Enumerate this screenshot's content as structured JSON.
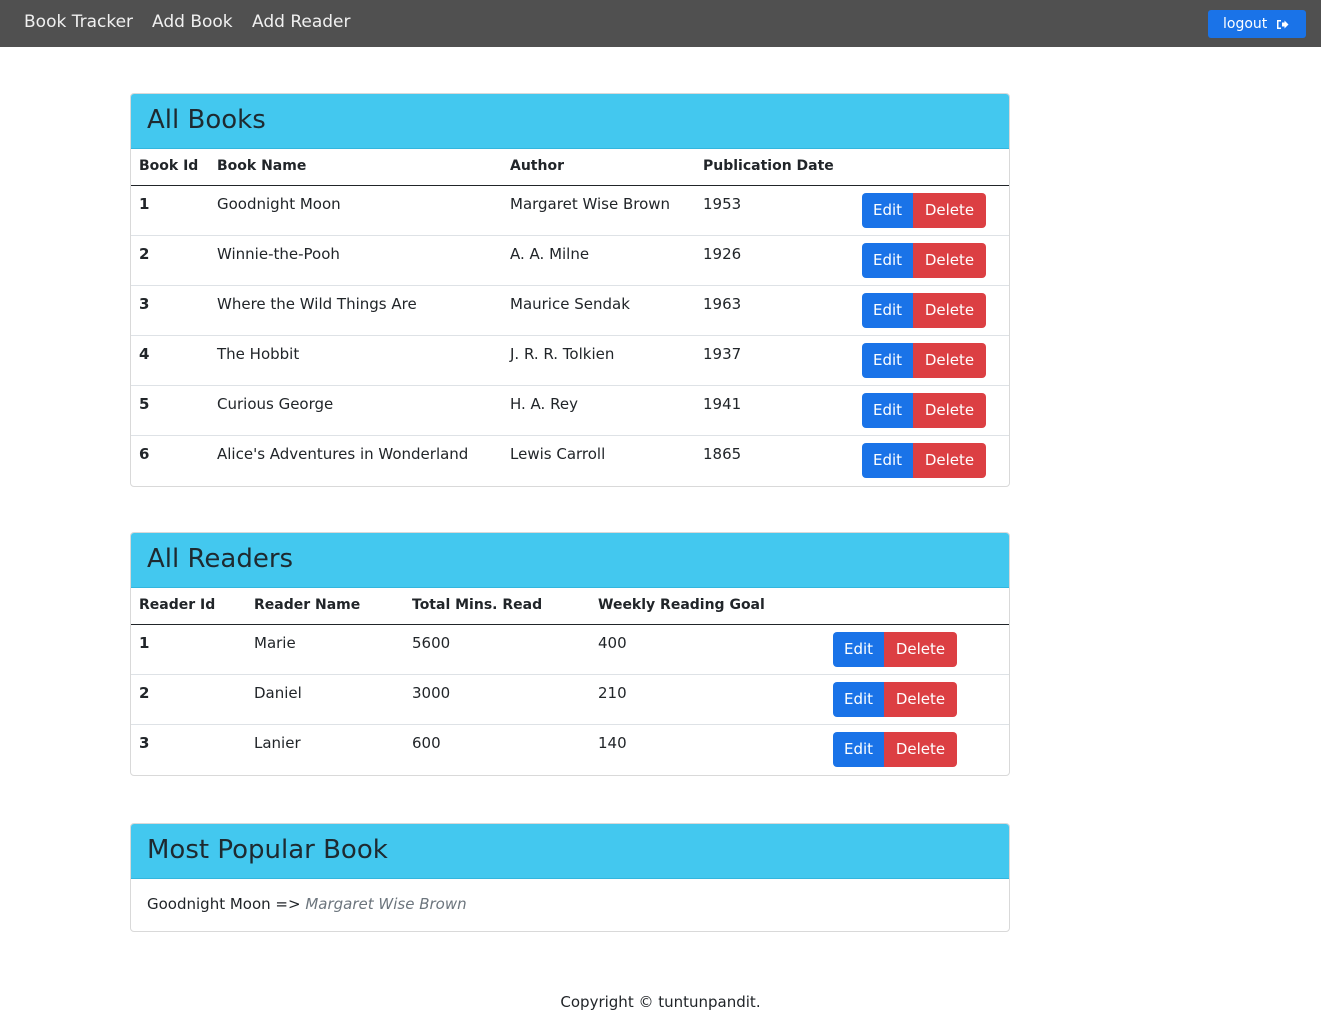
{
  "nav": {
    "brand": "Book Tracker",
    "add_book": "Add Book",
    "add_reader": "Add Reader",
    "logout": "logout",
    "logout_icon": "sign-out-icon"
  },
  "books": {
    "title": "All Books",
    "columns": [
      "Book Id",
      "Book Name",
      "Author",
      "Publication Date"
    ],
    "rows": [
      {
        "id": "1",
        "name": "Goodnight Moon",
        "author": "Margaret Wise Brown",
        "date": "1953"
      },
      {
        "id": "2",
        "name": "Winnie-the-Pooh",
        "author": "A. A. Milne",
        "date": "1926"
      },
      {
        "id": "3",
        "name": "Where the Wild Things Are",
        "author": "Maurice Sendak",
        "date": "1963"
      },
      {
        "id": "4",
        "name": "The Hobbit",
        "author": "J. R. R. Tolkien",
        "date": "1937"
      },
      {
        "id": "5",
        "name": "Curious George",
        "author": "H. A. Rey",
        "date": "1941"
      },
      {
        "id": "6",
        "name": "Alice's Adventures in Wonderland",
        "author": "Lewis Carroll",
        "date": "1865"
      }
    ]
  },
  "readers": {
    "title": "All Readers",
    "columns": [
      "Reader Id",
      "Reader Name",
      "Total Mins. Read",
      "Weekly Reading Goal"
    ],
    "rows": [
      {
        "id": "1",
        "name": "Marie",
        "mins": "5600",
        "goal": "400"
      },
      {
        "id": "2",
        "name": "Daniel",
        "mins": "3000",
        "goal": "210"
      },
      {
        "id": "3",
        "name": "Lanier",
        "mins": "600",
        "goal": "140"
      }
    ]
  },
  "buttons": {
    "edit": "Edit",
    "delete": "Delete"
  },
  "popular": {
    "title": "Most Popular Book",
    "book": "Goodnight Moon",
    "separator": " => ",
    "author": "Margaret Wise Brown"
  },
  "footer": "Copyright © tuntunpandit.",
  "colors": {
    "navbar": "#505050",
    "header": "#43c8ef",
    "primary": "#1a73e8",
    "danger": "#dc3f43"
  }
}
